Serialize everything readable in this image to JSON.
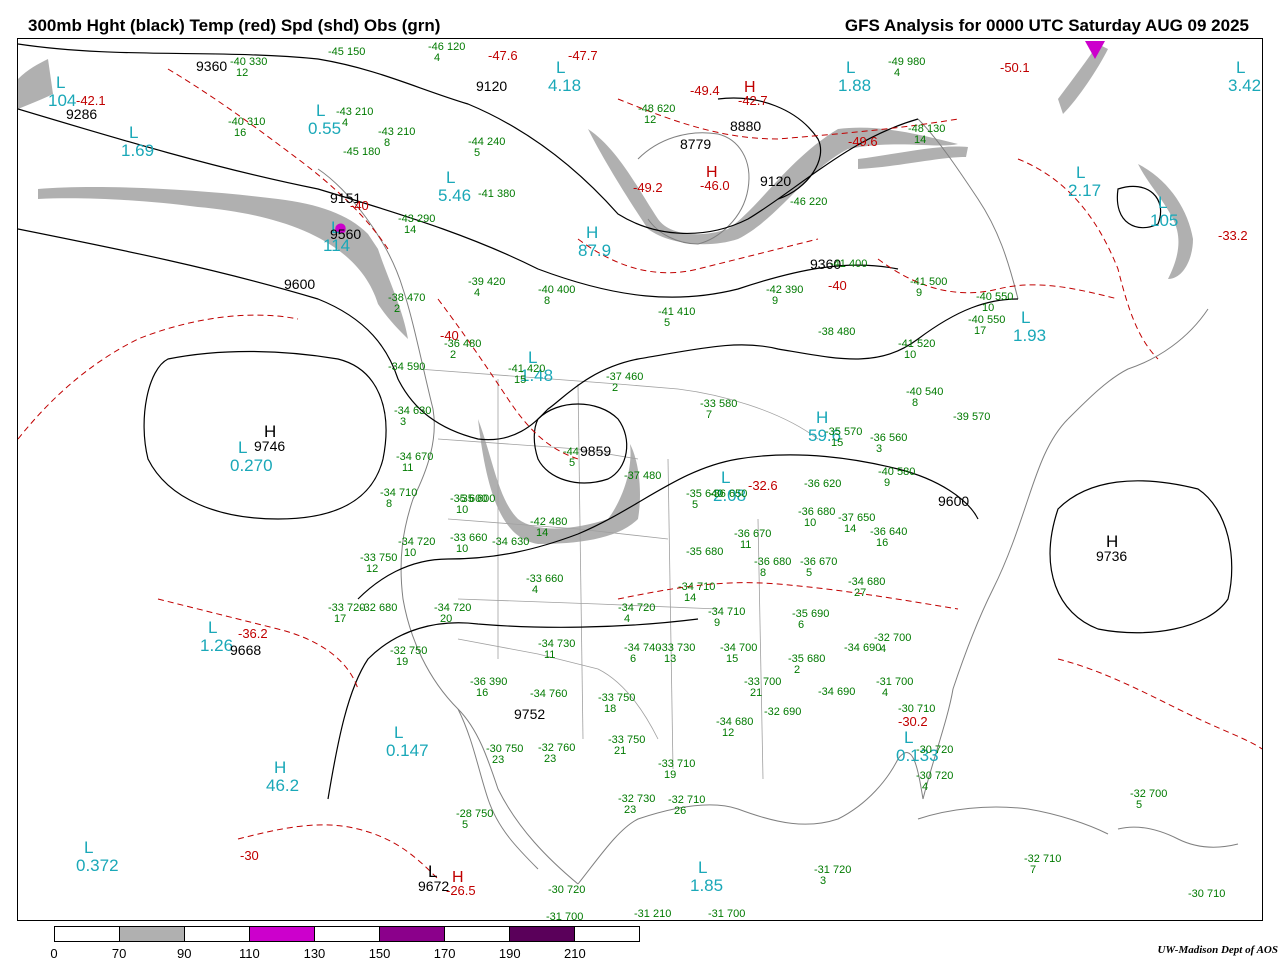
{
  "header": {
    "title_left": "300mb Hght (black) Temp (red) Spd (shd) Obs (grn)",
    "title_right": "GFS Analysis for 0000 UTC Saturday  AUG 09 2025"
  },
  "colors": {
    "height_contours": "#000000",
    "temperature_contours": "#c00000",
    "speed_shading": "#b0b0b0",
    "observations": "#007a00",
    "pressure_centers": "#1aa8b8",
    "political_boundaries": "#808080"
  },
  "pressure_centers": [
    {
      "type": "L",
      "value": "104"
    },
    {
      "type": "L",
      "value": "1.69"
    },
    {
      "type": "L",
      "value": "0.55"
    },
    {
      "type": "L",
      "value": "4.18"
    },
    {
      "type": "L",
      "value": "1.88"
    },
    {
      "type": "L",
      "value": "3.42"
    },
    {
      "type": "L",
      "value": "5.46"
    },
    {
      "type": "H",
      "value": "87.9"
    },
    {
      "type": "L",
      "value": "2.17"
    },
    {
      "type": "L",
      "value": "105"
    },
    {
      "type": "L",
      "value": "114"
    },
    {
      "type": "L",
      "value": "1.93"
    },
    {
      "type": "L",
      "value": "0.270"
    },
    {
      "type": "H",
      "value": "59.6"
    },
    {
      "type": "L",
      "value": "2.08"
    },
    {
      "type": "L",
      "value": "1.26"
    },
    {
      "type": "L",
      "value": "0.147"
    },
    {
      "type": "H",
      "value": "46.2"
    },
    {
      "type": "L",
      "value": "0.372"
    },
    {
      "type": "L",
      "value": "1.85"
    },
    {
      "type": "L",
      "value": "0.133"
    },
    {
      "type": "L",
      "value": "1.48"
    }
  ],
  "height_labels": [
    {
      "type": "",
      "value": "9360"
    },
    {
      "type": "",
      "value": "9286"
    },
    {
      "type": "",
      "value": "9120"
    },
    {
      "type": "",
      "value": "8880"
    },
    {
      "type": "",
      "value": "8779"
    },
    {
      "type": "",
      "value": "9120"
    },
    {
      "type": "",
      "value": "9151"
    },
    {
      "type": "",
      "value": "9360"
    },
    {
      "type": "",
      "value": "9600"
    },
    {
      "type": "",
      "value": "9560"
    },
    {
      "type": "H",
      "value": "9746"
    },
    {
      "type": "",
      "value": "9859"
    },
    {
      "type": "H",
      "value": "9736"
    },
    {
      "type": "",
      "value": "9600"
    },
    {
      "type": "",
      "value": "9668"
    },
    {
      "type": "",
      "value": "9752"
    },
    {
      "type": "L",
      "value": "9672"
    }
  ],
  "temperature_labels": [
    {
      "type": "",
      "value": "-42.1"
    },
    {
      "type": "",
      "value": "-47.6"
    },
    {
      "type": "",
      "value": "-47.7"
    },
    {
      "type": "",
      "value": "-50.1"
    },
    {
      "type": "",
      "value": "-49.4"
    },
    {
      "type": "H",
      "value": "-42.7"
    },
    {
      "type": "",
      "value": "-49.6"
    },
    {
      "type": "",
      "value": "-49.2"
    },
    {
      "type": "H",
      "value": "-46.0"
    },
    {
      "type": "",
      "value": "-33.2"
    },
    {
      "type": "",
      "value": "-40"
    },
    {
      "type": "",
      "value": "-40"
    },
    {
      "type": "",
      "value": "-40"
    },
    {
      "type": "",
      "value": "-32.6"
    },
    {
      "type": "",
      "value": "-36.2"
    },
    {
      "type": "",
      "value": "-30.2"
    },
    {
      "type": "",
      "value": "-30"
    },
    {
      "type": "H",
      "value": "-26.5"
    }
  ],
  "observations": [
    {
      "temp": "-40",
      "height": "330",
      "spd": "12"
    },
    {
      "temp": "-45",
      "height": "150",
      "spd": ""
    },
    {
      "temp": "-46",
      "height": "120",
      "spd": "4"
    },
    {
      "temp": "-43",
      "height": "210",
      "spd": "4"
    },
    {
      "temp": "-40",
      "height": "310",
      "spd": "16"
    },
    {
      "temp": "-43",
      "height": "210",
      "spd": "8"
    },
    {
      "temp": "-45",
      "height": "180",
      "spd": ""
    },
    {
      "temp": "-44",
      "height": "240",
      "spd": "5"
    },
    {
      "temp": "-48",
      "height": "620",
      "spd": "12"
    },
    {
      "temp": "-49",
      "height": "980",
      "spd": "4"
    },
    {
      "temp": "-48",
      "height": "130",
      "spd": "14"
    },
    {
      "temp": "-41",
      "height": "380",
      "spd": ""
    },
    {
      "temp": "-43",
      "height": "290",
      "spd": "14"
    },
    {
      "temp": "-46",
      "height": "220",
      "spd": ""
    },
    {
      "temp": "-39",
      "height": "420",
      "spd": "4"
    },
    {
      "temp": "-40",
      "height": "400",
      "spd": "8"
    },
    {
      "temp": "-42",
      "height": "390",
      "spd": "9"
    },
    {
      "temp": "-41",
      "height": "400",
      "spd": ""
    },
    {
      "temp": "-41",
      "height": "500",
      "spd": "9"
    },
    {
      "temp": "-40",
      "height": "550",
      "spd": "10"
    },
    {
      "temp": "-40",
      "height": "550",
      "spd": "17"
    },
    {
      "temp": "-38",
      "height": "470",
      "spd": "2"
    },
    {
      "temp": "-36",
      "height": "480",
      "spd": "2"
    },
    {
      "temp": "-41",
      "height": "410",
      "spd": "5"
    },
    {
      "temp": "-38",
      "height": "480",
      "spd": ""
    },
    {
      "temp": "-41",
      "height": "520",
      "spd": "10"
    },
    {
      "temp": "-34",
      "height": "590",
      "spd": ""
    },
    {
      "temp": "-41",
      "height": "420",
      "spd": "15"
    },
    {
      "temp": "-37",
      "height": "460",
      "spd": "2"
    },
    {
      "temp": "-33",
      "height": "580",
      "spd": "7"
    },
    {
      "temp": "-40",
      "height": "540",
      "spd": "8"
    },
    {
      "temp": "-39",
      "height": "570",
      "spd": ""
    },
    {
      "temp": "-34",
      "height": "630",
      "spd": "3"
    },
    {
      "temp": "-36",
      "height": "560",
      "spd": "3"
    },
    {
      "temp": "-35",
      "height": "570",
      "spd": "15"
    },
    {
      "temp": "-34",
      "height": "670",
      "spd": "11"
    },
    {
      "temp": "-44",
      "height": "",
      "spd": "5"
    },
    {
      "temp": "-35",
      "height": "600",
      "spd": ""
    },
    {
      "temp": "-40",
      "height": "580",
      "spd": "9"
    },
    {
      "temp": "-34",
      "height": "710",
      "spd": "8"
    },
    {
      "temp": "-35",
      "height": "600",
      "spd": "10"
    },
    {
      "temp": "-37",
      "height": "480",
      "spd": ""
    },
    {
      "temp": "-36",
      "height": "650",
      "spd": ""
    },
    {
      "temp": "-36",
      "height": "620",
      "spd": ""
    },
    {
      "temp": "-42",
      "height": "480",
      "spd": "14"
    },
    {
      "temp": "-35",
      "height": "640",
      "spd": "5"
    },
    {
      "temp": "-36",
      "height": "680",
      "spd": "10"
    },
    {
      "temp": "-37",
      "height": "650",
      "spd": "14"
    },
    {
      "temp": "-36",
      "height": "640",
      "spd": "16"
    },
    {
      "temp": "-34",
      "height": "720",
      "spd": "10"
    },
    {
      "temp": "-33",
      "height": "660",
      "spd": "10"
    },
    {
      "temp": "-34",
      "height": "630",
      "spd": ""
    },
    {
      "temp": "-36",
      "height": "670",
      "spd": "11"
    },
    {
      "temp": "-35",
      "height": "680",
      "spd": ""
    },
    {
      "temp": "-36",
      "height": "680",
      "spd": "8"
    },
    {
      "temp": "-36",
      "height": "670",
      "spd": "5"
    },
    {
      "temp": "-34",
      "height": "680",
      "spd": "27"
    },
    {
      "temp": "-33",
      "height": "750",
      "spd": "12"
    },
    {
      "temp": "-33",
      "height": "660",
      "spd": "4"
    },
    {
      "temp": "-34",
      "height": "710",
      "spd": "14"
    },
    {
      "temp": "-32",
      "height": "680",
      "spd": ""
    },
    {
      "temp": "-33",
      "height": "720",
      "spd": "17"
    },
    {
      "temp": "-34",
      "height": "720",
      "spd": "20"
    },
    {
      "temp": "-34",
      "height": "720",
      "spd": "4"
    },
    {
      "temp": "-34",
      "height": "710",
      "spd": "9"
    },
    {
      "temp": "-35",
      "height": "690",
      "spd": "6"
    },
    {
      "temp": "-32",
      "height": "700",
      "spd": "4"
    },
    {
      "temp": "-32",
      "height": "750",
      "spd": "19"
    },
    {
      "temp": "-34",
      "height": "730",
      "spd": "11"
    },
    {
      "temp": "-34",
      "height": "740",
      "spd": "6"
    },
    {
      "temp": "-33",
      "height": "730",
      "spd": "13"
    },
    {
      "temp": "-34",
      "height": "700",
      "spd": "15"
    },
    {
      "temp": "-35",
      "height": "680",
      "spd": "2"
    },
    {
      "temp": "-34",
      "height": "690",
      "spd": ""
    },
    {
      "temp": "-36",
      "height": "390",
      "spd": "16"
    },
    {
      "temp": "-34",
      "height": "760",
      "spd": ""
    },
    {
      "temp": "-33",
      "height": "750",
      "spd": "18"
    },
    {
      "temp": "-33",
      "height": "700",
      "spd": "21"
    },
    {
      "temp": "-34",
      "height": "690",
      "spd": ""
    },
    {
      "temp": "-31",
      "height": "700",
      "spd": "4"
    },
    {
      "temp": "-34",
      "height": "680",
      "spd": "12"
    },
    {
      "temp": "-32",
      "height": "690",
      "spd": ""
    },
    {
      "temp": "-30",
      "height": "710",
      "spd": ""
    },
    {
      "temp": "-30",
      "height": "750",
      "spd": "23"
    },
    {
      "temp": "-32",
      "height": "760",
      "spd": "23"
    },
    {
      "temp": "-33",
      "height": "750",
      "spd": "21"
    },
    {
      "temp": "-33",
      "height": "710",
      "spd": "19"
    },
    {
      "temp": "-30",
      "height": "720",
      "spd": ""
    },
    {
      "temp": "-30",
      "height": "720",
      "spd": "4"
    },
    {
      "temp": "-32",
      "height": "730",
      "spd": "23"
    },
    {
      "temp": "-32",
      "height": "710",
      "spd": "26"
    },
    {
      "temp": "-28",
      "height": "750",
      "spd": "5"
    },
    {
      "temp": "-32",
      "height": "700",
      "spd": "5"
    },
    {
      "temp": "-31",
      "height": "720",
      "spd": "3"
    },
    {
      "temp": "-32",
      "height": "710",
      "spd": "7"
    },
    {
      "temp": "-30",
      "height": "710",
      "spd": ""
    },
    {
      "temp": "-30",
      "height": "720",
      "spd": ""
    },
    {
      "temp": "-31",
      "height": "700",
      "spd": ""
    },
    {
      "temp": "-31",
      "height": "210",
      "spd": ""
    },
    {
      "temp": "-31",
      "height": "700",
      "spd": "3"
    }
  ],
  "colorbar": {
    "ticks": [
      "0",
      "70",
      "90",
      "110",
      "130",
      "150",
      "170",
      "190",
      "210"
    ],
    "segment_colors": [
      "#ffffff",
      "#b0b0b0",
      "#ffffff",
      "#cc00cc",
      "#ffffff",
      "#8b008b",
      "#ffffff",
      "#5a005a",
      "#ffffff"
    ]
  },
  "credit": "UW-Madison  Dept of AOS"
}
